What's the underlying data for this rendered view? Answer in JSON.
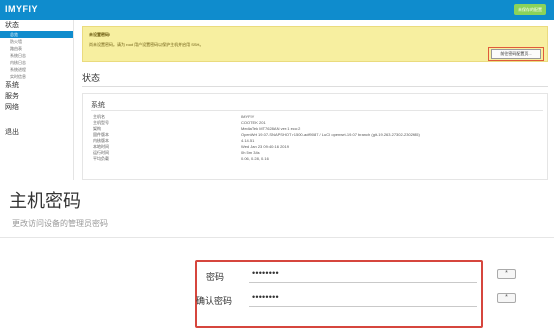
{
  "header": {
    "brand": "IMYFIY",
    "unsaved_badge": "未保存的配置"
  },
  "sidebar": {
    "status_group": "状态",
    "status_items": [
      "总览",
      "防火墙",
      "路由表",
      "系统日志",
      "内核日志",
      "系统进程",
      "实时信息"
    ],
    "groups": [
      "系统",
      "服务",
      "网络"
    ],
    "logout": "退出"
  },
  "warning": {
    "title": "未设置密码!",
    "text": "尚未设置密码。请为 root 用户设置密码以保护主机并启用 SSH。",
    "button": "前往密码配置页..."
  },
  "status": {
    "title": "状态",
    "system_title": "系统",
    "rows": [
      {
        "label": "主机名",
        "value": "IMYFIY"
      },
      {
        "label": "主机型号",
        "value": "COOTEK 201"
      },
      {
        "label": "架构",
        "value": "MediaTek MT7628AN ver:1 eco:2"
      },
      {
        "label": "固件版本",
        "value": "OpenWrt 19.07-SNAPSHOT r1500-adf9087 / LuCI openwrt-19.07 branch (git-19.263.27302-2302f85)"
      },
      {
        "label": "内核版本",
        "value": "4.14.51"
      },
      {
        "label": "本地时间",
        "value": "Wed Jan 23 09:40:16 2019"
      },
      {
        "label": "运行时间",
        "value": "0h 5m 34s"
      },
      {
        "label": "平均负载",
        "value": "0.06, 0.28, 0.16"
      }
    ]
  },
  "password_section": {
    "title": "主机密码",
    "description": "更改访问设备的管理员密码",
    "password_label": "密码",
    "password_value": "••••••••",
    "confirm_label": "确认密码",
    "confirm_value": "••••••••",
    "reveal_icon": "*"
  },
  "colors": {
    "topbar": "#0f8ccd",
    "warning_bg": "#f7efa0",
    "highlight_border": "#d6463d"
  }
}
